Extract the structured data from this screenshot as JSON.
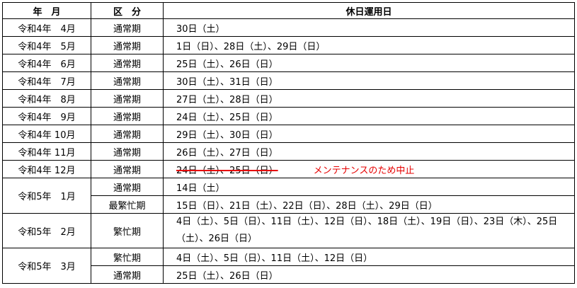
{
  "header": {
    "year_month": "年　月",
    "category": "区　分",
    "dates": "休日運用日"
  },
  "rows": [
    {
      "ym": "令和4年　4月",
      "kb": "通常期",
      "dt": "30日（土）"
    },
    {
      "ym": "令和4年　5月",
      "kb": "通常期",
      "dt": "1日（日）、28日（土）、29日（日）"
    },
    {
      "ym": "令和4年　6月",
      "kb": "通常期",
      "dt": "25日（土）、26日（日）"
    },
    {
      "ym": "令和4年　7月",
      "kb": "通常期",
      "dt": "30日（土）、31日（日）"
    },
    {
      "ym": "令和4年　8月",
      "kb": "通常期",
      "dt": "27日（土）、28日（日）"
    },
    {
      "ym": "令和4年　9月",
      "kb": "通常期",
      "dt": "24日（土）、25日（日）"
    },
    {
      "ym": "令和4年 10月",
      "kb": "通常期",
      "dt": "29日（土）、30日（日）"
    },
    {
      "ym": "令和4年 11月",
      "kb": "通常期",
      "dt": "26日（土）、27日（日）"
    },
    {
      "ym": "令和4年 12月",
      "kb": "通常期",
      "dt": "24日（土）、25日（日）",
      "note": "メンテナンスのため中止"
    },
    {
      "ym": "令和5年　1月",
      "kb": "通常期",
      "dt": "14日（土）"
    },
    {
      "kb": "最繁忙期",
      "dt": "15日（日）、21日（土）、22日（日）、28日（土）、29日（日）"
    },
    {
      "ym": "令和5年　2月",
      "kb": "繁忙期",
      "dt": "4日（土）、5日（日）、11日（土）、12日（日）、18日（土）、19日（日）、23日（木）、25日（土）、26日（日）"
    },
    {
      "ym": "令和5年　3月",
      "kb": "繁忙期",
      "dt": "4日（土）、5日（日）、11日（土）、12日（日）"
    },
    {
      "kb": "通常期",
      "dt": "25日（土）、26日（日）"
    }
  ]
}
